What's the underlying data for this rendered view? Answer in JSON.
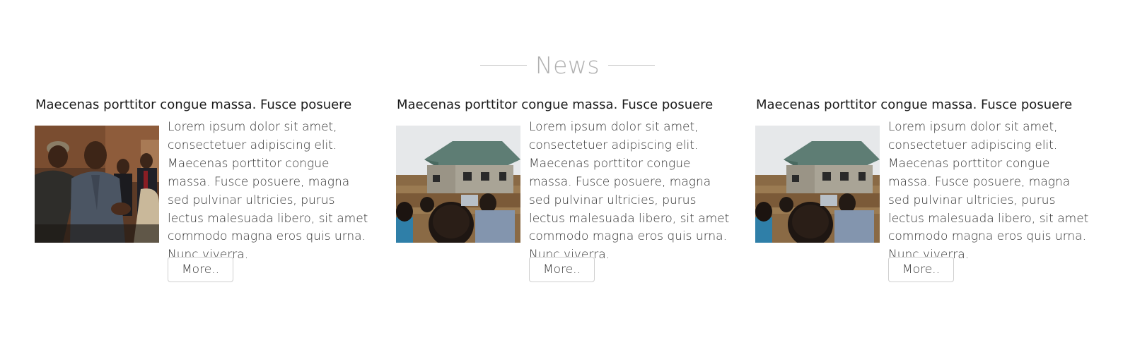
{
  "section": {
    "title": "News"
  },
  "cards": [
    {
      "title": "Maecenas porttitor congue massa. Fusce posuere",
      "body": "Lorem ipsum dolor sit amet, consectetuer adipiscing elit. Maecenas porttitor congue massa. Fusce posuere, magna sed pulvinar ultricies, purus lectus malesuada libero, sit amet commodo magna eros quis urna. Nunc viverra.",
      "button_label": "More..",
      "image": "photo-handshake-meeting"
    },
    {
      "title": "Maecenas porttitor congue massa. Fusce posuere",
      "body": "Lorem ipsum dolor sit amet, consectetuer adipiscing elit. Maecenas porttitor congue massa. Fusce posuere, magna sed pulvinar ultricies, purus lectus malesuada libero, sit amet commodo magna eros quis urna. Nunc viverra.",
      "button_label": "More..",
      "image": "photo-building-site"
    },
    {
      "title": "Maecenas porttitor congue massa. Fusce posuere",
      "body": "Lorem ipsum dolor sit amet, consectetuer adipiscing elit. Maecenas porttitor congue massa. Fusce posuere, magna sed pulvinar ultricies, purus lectus malesuada libero, sit amet commodo magna eros quis urna. Nunc viverra.",
      "button_label": "More..",
      "image": "photo-building-site"
    }
  ]
}
